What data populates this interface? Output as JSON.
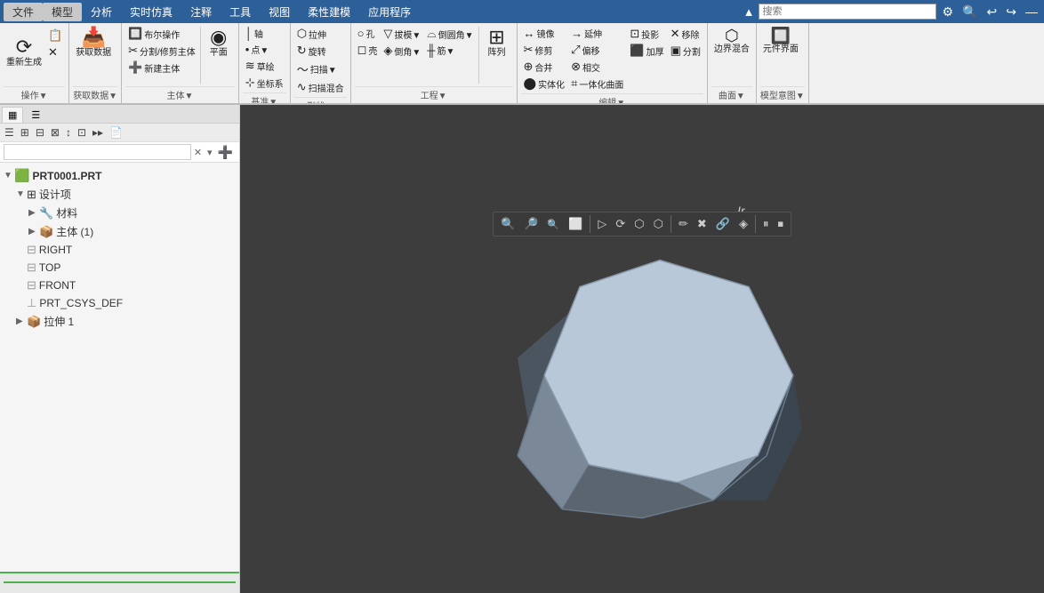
{
  "menubar": {
    "items": [
      "文件",
      "模型",
      "分析",
      "实时仿真",
      "注释",
      "工具",
      "视图",
      "柔性建模",
      "应用程序"
    ],
    "active_index": 1,
    "search_placeholder": "搜索",
    "icons": [
      "⚙",
      "🔍",
      "↩",
      "↪",
      "—"
    ]
  },
  "ribbon": {
    "groups": [
      {
        "label": "操作▼",
        "buttons": [
          {
            "icon": "⟳",
            "label": "重新生成",
            "tall": true
          },
          {
            "icon": "📋",
            "label": "",
            "small": true
          },
          {
            "icon": "✕",
            "label": "",
            "small": true
          }
        ]
      },
      {
        "label": "获取数据▼",
        "buttons": [
          {
            "icon": "📥",
            "label": "获取数据",
            "small": false
          }
        ]
      },
      {
        "label": "主体▼",
        "rows": [
          [
            {
              "icon": "🔲",
              "label": "布尔操作"
            },
            {
              "icon": "✂",
              "label": "分割/修剪主体"
            },
            {
              "icon": "➕",
              "label": "新建主体"
            }
          ],
          [
            {
              "icon": "◉",
              "label": "平面"
            }
          ]
        ]
      },
      {
        "label": "基准▼",
        "rows": [
          [
            {
              "icon": "│",
              "label": "轴"
            },
            {
              "icon": "•",
              "label": "点▼"
            },
            {
              "icon": "≋",
              "label": "草绘"
            },
            {
              "icon": "⊹",
              "label": "坐标系"
            }
          ]
        ]
      },
      {
        "label": "形状▼",
        "rows": [
          [
            {
              "icon": "⬡",
              "label": "拉伸"
            },
            {
              "icon": "↻",
              "label": "旋转"
            },
            {
              "icon": "〜",
              "label": "扫描▼"
            },
            {
              "icon": "∿",
              "label": "扫描混合"
            }
          ]
        ]
      },
      {
        "label": "工程▼",
        "rows": [
          [
            {
              "icon": "○",
              "label": "孔"
            },
            {
              "icon": "▽",
              "label": "拔模▼"
            },
            {
              "icon": "⌓",
              "label": "倒圆角▼"
            },
            {
              "icon": "◻",
              "label": "壳"
            },
            {
              "icon": "◈",
              "label": "倒角▼"
            },
            {
              "icon": "╫",
              "label": "筋▼"
            }
          ]
        ]
      },
      {
        "label": "编辑▼",
        "rows": [
          [
            {
              "icon": "↔",
              "label": "镜像"
            },
            {
              "icon": "→",
              "label": "延伸"
            },
            {
              "icon": "⊡",
              "label": "投影"
            },
            {
              "icon": "✕",
              "label": "移除"
            },
            {
              "icon": "✂",
              "label": "修剪"
            },
            {
              "icon": "⤢",
              "label": "偏移"
            },
            {
              "icon": "⬛",
              "label": "加厚"
            },
            {
              "icon": "▣",
              "label": "分割"
            },
            {
              "icon": "⊕",
              "label": "合并"
            },
            {
              "icon": "⊗",
              "label": "相交"
            },
            {
              "icon": "⬤",
              "label": "实体化"
            },
            {
              "icon": "⌗",
              "label": "一体化曲面"
            }
          ]
        ]
      },
      {
        "label": "曲面▼",
        "rows": [
          [
            {
              "icon": "⬡",
              "label": "边界混合"
            }
          ]
        ]
      },
      {
        "label": "模型意图▼",
        "rows": [
          [
            {
              "icon": "⬡",
              "label": "元件界面"
            }
          ]
        ]
      }
    ]
  },
  "toolbar2": {
    "buttons": [
      "🔍",
      "🔎",
      "🔍",
      "⬜",
      "▷",
      "⬡",
      "⬡",
      "⬡",
      "⬡",
      "✏",
      "✖",
      "🔗",
      "◈",
      "⏸",
      "⏹"
    ]
  },
  "left_panel": {
    "tabs": [
      "▦",
      "☰"
    ],
    "toolbar_icons": [
      "☰",
      "⊞",
      "⊟",
      "⊠",
      "↕",
      "⊡",
      "▸▸",
      "📄"
    ],
    "search_placeholder": "",
    "tree": [
      {
        "level": 0,
        "icon": "🟩",
        "label": "PRT0001.PRT",
        "expand": "▼",
        "has_expand": true
      },
      {
        "level": 1,
        "icon": "⊞",
        "label": "设计项",
        "expand": "▼",
        "has_expand": true
      },
      {
        "level": 2,
        "icon": "🔧",
        "label": "材料",
        "expand": "▶",
        "has_expand": true
      },
      {
        "level": 2,
        "icon": "📦",
        "label": "主体 (1)",
        "expand": "▶",
        "has_expand": true
      },
      {
        "level": 1,
        "icon": "⊟",
        "label": "RIGHT",
        "expand": "",
        "has_expand": false
      },
      {
        "level": 1,
        "icon": "⊟",
        "label": "TOP",
        "expand": "",
        "has_expand": false
      },
      {
        "level": 1,
        "icon": "⊟",
        "label": "FRONT",
        "expand": "",
        "has_expand": false
      },
      {
        "level": 1,
        "icon": "⊥",
        "label": "PRT_CSYS_DEF",
        "expand": "",
        "has_expand": false
      },
      {
        "level": 1,
        "icon": "📦",
        "label": "拉伸 1",
        "expand": "▶",
        "has_expand": true
      }
    ],
    "bottom_bar": ""
  },
  "shape": {
    "description": "dodecahedron-like 3D polygon",
    "top_face_color": "#b8c8d8",
    "side_face_light": "#8898a8",
    "side_face_dark": "#4a5560",
    "bottom_face_color": "#5a6570"
  },
  "colors": {
    "menu_bg": "#2d6099",
    "ribbon_bg": "#f0f0f0",
    "viewport_bg": "#3d3d3d",
    "panel_bg": "#f5f5f5",
    "accent_green": "#4caf50"
  }
}
